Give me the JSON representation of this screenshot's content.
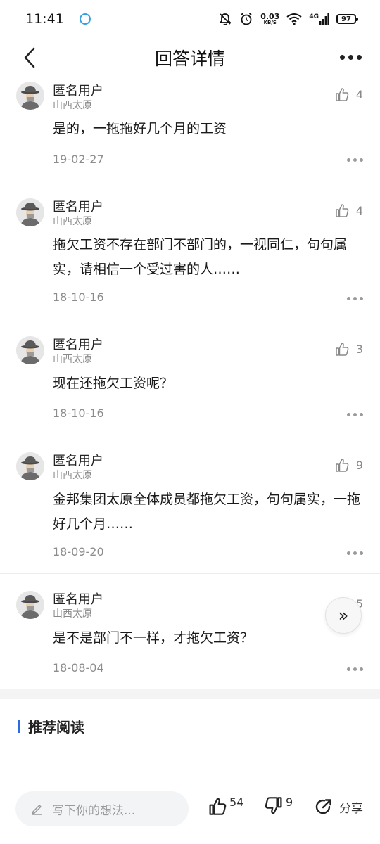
{
  "status_bar": {
    "time": "11:41",
    "net_speed_value": "0.03",
    "net_speed_unit": "KB/S",
    "network_type": "4G",
    "battery": "97"
  },
  "header": {
    "title": "回答详情"
  },
  "answers": [
    {
      "user": "匿名用户",
      "location": "山西太原",
      "likes": "4",
      "text": "是的，一拖拖好几个月的工资",
      "date": "19-02-27"
    },
    {
      "user": "匿名用户",
      "location": "山西太原",
      "likes": "4",
      "text": "拖欠工资不存在部门不部门的，一视同仁，句句属实，请相信一个受过害的人……",
      "date": "18-10-16"
    },
    {
      "user": "匿名用户",
      "location": "山西太原",
      "likes": "3",
      "text": "现在还拖欠工资呢？",
      "date": "18-10-16"
    },
    {
      "user": "匿名用户",
      "location": "山西太原",
      "likes": "9",
      "text": "金邦集团太原全体成员都拖欠工资，句句属实，一拖好几个月……",
      "date": "18-09-20"
    },
    {
      "user": "匿名用户",
      "location": "山西太原",
      "likes": "5",
      "text": "是不是部门不一样，才拖欠工资？",
      "date": "18-08-04"
    }
  ],
  "recommend": {
    "title": "推荐阅读"
  },
  "floating_button": {
    "label": "»"
  },
  "bottom_bar": {
    "input_placeholder": "写下你的想法...",
    "like_count": "54",
    "dislike_count": "9",
    "share_label": "分享"
  }
}
